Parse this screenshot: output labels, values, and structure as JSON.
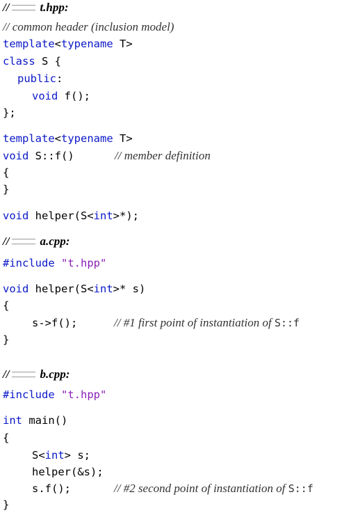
{
  "files": {
    "thpp": {
      "prefix": "//",
      "name": "t.hpp:"
    },
    "acpp": {
      "prefix": "//",
      "name": "a.cpp:"
    },
    "bcpp": {
      "prefix": "//",
      "name": "b.cpp:"
    }
  },
  "code": {
    "t_comment": "// common header (inclusion model)",
    "template_kw": "template",
    "typename_kw": "typename",
    "typename_T": " T>",
    "lt": "<",
    "class_kw": "class",
    "class_rest": " S {",
    "public_kw": "public",
    "colon": ":",
    "void_kw": "void",
    "f_decl": " f();",
    "close_brace_semi": "};",
    "sf_def": " S::f()",
    "member_def_comment": "// member definition",
    "open_brace": "{",
    "close_brace": "}",
    "helper_decl_a": " helper(S<",
    "int_kw": "int",
    "helper_decl_b": ">*);",
    "include_kw": "#include",
    "include_str": "\"t.hpp\"",
    "helper_def_b": ">* s)",
    "call_f": "s->f();",
    "poi1_comment": "// #1 first point of instantiation of",
    "sf_ref": "S::f",
    "main_rest": " main()",
    "s_decl_a": "S<",
    "s_decl_b": "> s;",
    "helper_call": "helper(&s);",
    "sf_call": "s.f();",
    "poi2_comment": "// #2 second point of instantiation of"
  }
}
